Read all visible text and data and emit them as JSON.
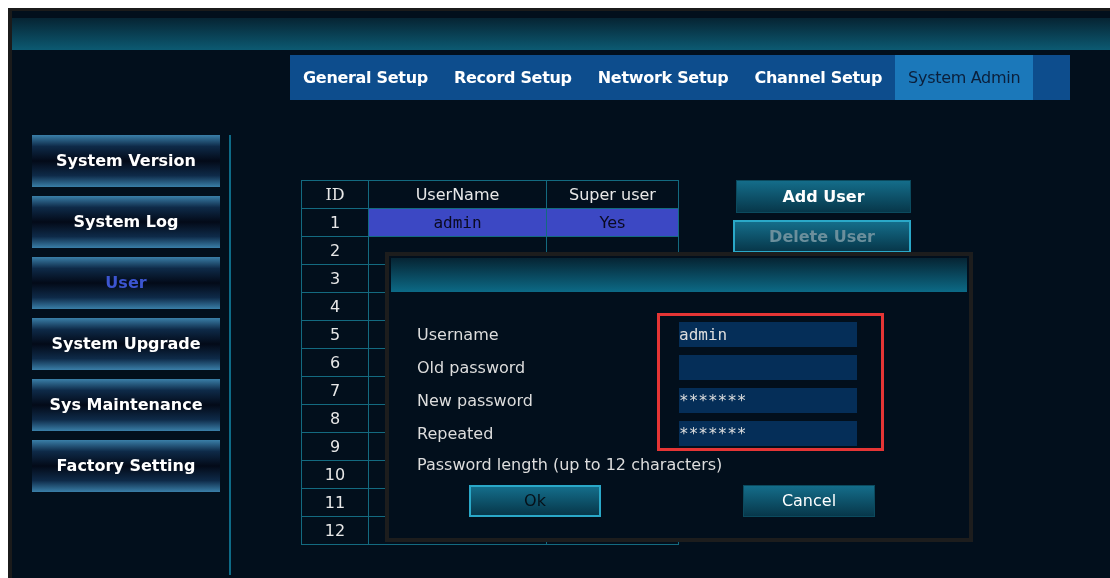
{
  "tabs": [
    {
      "label": "General Setup",
      "selected": false
    },
    {
      "label": "Record Setup",
      "selected": false
    },
    {
      "label": "Network Setup",
      "selected": false
    },
    {
      "label": "Channel Setup",
      "selected": false
    },
    {
      "label": "System Admin",
      "selected": true
    }
  ],
  "sidebar": {
    "items": [
      {
        "label": "System Version",
        "selected": false
      },
      {
        "label": "System Log",
        "selected": false
      },
      {
        "label": "User",
        "selected": true
      },
      {
        "label": "System Upgrade",
        "selected": false
      },
      {
        "label": "Sys Maintenance",
        "selected": false
      },
      {
        "label": "Factory Setting",
        "selected": false
      }
    ]
  },
  "user_table": {
    "columns": [
      "ID",
      "UserName",
      "Super user"
    ],
    "rows": [
      {
        "id": "1",
        "username": "admin",
        "super_user": "Yes",
        "selected": true
      },
      {
        "id": "2",
        "selected": false
      },
      {
        "id": "3",
        "selected": false
      },
      {
        "id": "4",
        "selected": false
      },
      {
        "id": "5",
        "selected": false
      },
      {
        "id": "6",
        "selected": false
      },
      {
        "id": "7",
        "selected": false
      },
      {
        "id": "8",
        "selected": false
      },
      {
        "id": "9",
        "selected": false
      },
      {
        "id": "10",
        "selected": false
      },
      {
        "id": "11",
        "selected": false
      },
      {
        "id": "12",
        "selected": false
      }
    ]
  },
  "actions": [
    {
      "label": "Add User",
      "disabled": false
    },
    {
      "label": "Delete User",
      "disabled": true
    }
  ],
  "dialog": {
    "fields": [
      {
        "label": "Username",
        "value": "admin"
      },
      {
        "label": "Old password"
      },
      {
        "label": "New password",
        "value": "*******"
      },
      {
        "label": "Repeated",
        "value": "*******"
      }
    ],
    "highlighted": true,
    "hint": "Password length (up to 12 characters)",
    "buttons": [
      {
        "label": "Ok",
        "focused": true
      },
      {
        "label": "Cancel",
        "focused": false
      }
    ]
  }
}
